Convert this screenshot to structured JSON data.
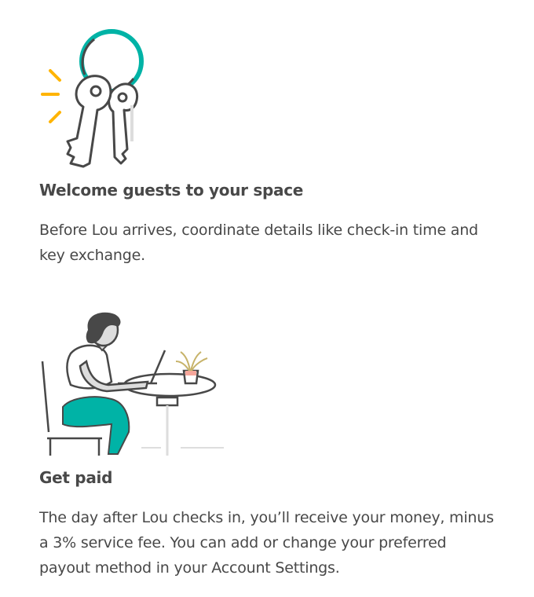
{
  "sections": [
    {
      "illustration_icon": "keys-illustration",
      "heading": "Welcome guests to your space",
      "description": "Before Lou arrives, coordinate details like check-in time and key exchange."
    },
    {
      "illustration_icon": "person-at-laptop-illustration",
      "heading": "Get paid",
      "description": "The day after Lou checks in, you’ll receive your money, minus a 3% service fee. You can add or change your preferred payout method in your Account Settings."
    }
  ],
  "colors": {
    "text": "#484848",
    "teal_accent": "#00B3A6",
    "yellow_accent": "#FFB400",
    "line_gray": "#484848",
    "light_gray": "#DDDDDD",
    "pink_accent": "#F6A69B"
  }
}
